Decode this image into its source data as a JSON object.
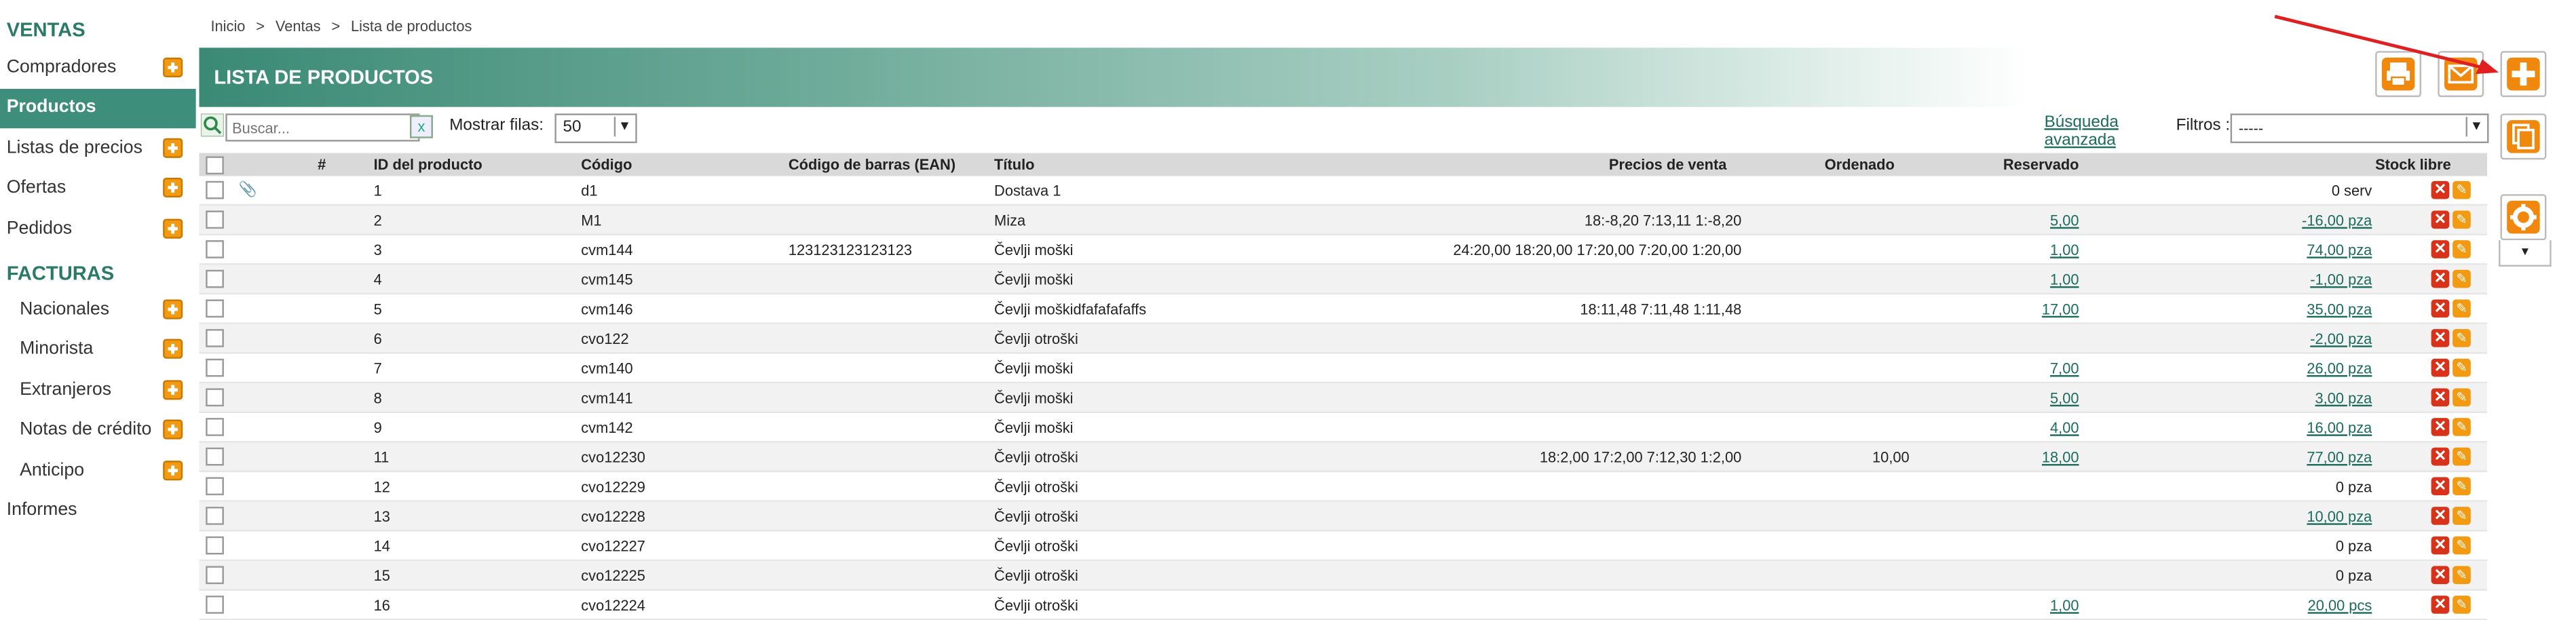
{
  "sidebar": {
    "ventas_title": "VENTAS",
    "ventas_items": [
      {
        "label": "Compradores",
        "active": false
      },
      {
        "label": "Productos",
        "active": true
      },
      {
        "label": "Listas de precios",
        "active": false
      },
      {
        "label": "Ofertas",
        "active": false
      },
      {
        "label": "Pedidos",
        "active": false
      }
    ],
    "facturas_title": "FACTURAS",
    "facturas_items": [
      {
        "label": "Nacionales"
      },
      {
        "label": "Minorista"
      },
      {
        "label": "Extranjeros"
      },
      {
        "label": "Notas de crédito"
      },
      {
        "label": "Anticipo"
      }
    ],
    "informes": "Informes"
  },
  "breadcrumb": [
    "Inicio",
    ">",
    "Ventas",
    ">",
    "Lista de productos"
  ],
  "header": {
    "title": "LISTA DE PRODUCTOS"
  },
  "toolbar": {
    "icons": [
      "print-icon",
      "mail-icon",
      "add-icon",
      "copy-icon",
      "gear-icon",
      "chevron-down-icon"
    ]
  },
  "controls": {
    "search_placeholder": "Buscar...",
    "search_clear": "x",
    "rows_label": "Mostrar filas:",
    "rows_value": "50",
    "adv_line1": "Búsqueda",
    "adv_line2": "avanzada",
    "filters_label": "Filtros :",
    "filters_value": "-----",
    "dropdown_arrow": "▼"
  },
  "table": {
    "headers": {
      "num": "#",
      "id": "ID del producto",
      "code": "Código",
      "ean": "Código de barras (EAN)",
      "title": "Título",
      "prices": "Precios de venta",
      "ordered": "Ordenado",
      "reserved": "Reservado",
      "stock": "Stock libre"
    },
    "rows": [
      {
        "id": "1",
        "code": "d1",
        "ean": "",
        "title": "Dostava 1",
        "prices": "",
        "ordered": "",
        "reserved": "",
        "stock": "0 serv",
        "stock_link": false,
        "clip": true
      },
      {
        "id": "2",
        "code": "M1",
        "ean": "",
        "title": "Miza",
        "prices": "18:-8,20 7:13,11 1:-8,20",
        "ordered": "",
        "reserved": "5,00",
        "stock": "-16,00 pza",
        "stock_link": true,
        "clip": false
      },
      {
        "id": "3",
        "code": "cvm144",
        "ean": "123123123123123",
        "title": "Čevlji moški",
        "prices": "24:20,00 18:20,00 17:20,00 7:20,00 1:20,00",
        "ordered": "",
        "reserved": "1,00",
        "stock": "74,00 pza",
        "stock_link": true,
        "clip": false
      },
      {
        "id": "4",
        "code": "cvm145",
        "ean": "",
        "title": "Čevlji moški",
        "prices": "",
        "ordered": "",
        "reserved": "1,00",
        "stock": "-1,00 pza",
        "stock_link": true,
        "clip": false
      },
      {
        "id": "5",
        "code": "cvm146",
        "ean": "",
        "title": "Čevlji moškidfafafafaffs",
        "prices": "18:11,48 7:11,48 1:11,48",
        "ordered": "",
        "reserved": "17,00",
        "stock": "35,00 pza",
        "stock_link": true,
        "clip": false
      },
      {
        "id": "6",
        "code": "cvo122",
        "ean": "",
        "title": "Čevlji otroški",
        "prices": "",
        "ordered": "",
        "reserved": "",
        "stock": "-2,00 pza",
        "stock_link": true,
        "clip": false
      },
      {
        "id": "7",
        "code": "cvm140",
        "ean": "",
        "title": "Čevlji moški",
        "prices": "",
        "ordered": "",
        "reserved": "7,00",
        "stock": "26,00 pza",
        "stock_link": true,
        "clip": false
      },
      {
        "id": "8",
        "code": "cvm141",
        "ean": "",
        "title": "Čevlji moški",
        "prices": "",
        "ordered": "",
        "reserved": "5,00",
        "stock": "3,00 pza",
        "stock_link": true,
        "clip": false
      },
      {
        "id": "9",
        "code": "cvm142",
        "ean": "",
        "title": "Čevlji moški",
        "prices": "",
        "ordered": "",
        "reserved": "4,00",
        "stock": "16,00 pza",
        "stock_link": true,
        "clip": false
      },
      {
        "id": "11",
        "code": "cvo12230",
        "ean": "",
        "title": "Čevlji otroški",
        "prices": "18:2,00 17:2,00 7:12,30 1:2,00",
        "ordered": "10,00",
        "reserved": "18,00",
        "stock": "77,00 pza",
        "stock_link": true,
        "clip": false
      },
      {
        "id": "12",
        "code": "cvo12229",
        "ean": "",
        "title": "Čevlji otroški",
        "prices": "",
        "ordered": "",
        "reserved": "",
        "stock": "0 pza",
        "stock_link": false,
        "clip": false
      },
      {
        "id": "13",
        "code": "cvo12228",
        "ean": "",
        "title": "Čevlji otroški",
        "prices": "",
        "ordered": "",
        "reserved": "",
        "stock": "10,00 pza",
        "stock_link": true,
        "clip": false
      },
      {
        "id": "14",
        "code": "cvo12227",
        "ean": "",
        "title": "Čevlji otroški",
        "prices": "",
        "ordered": "",
        "reserved": "",
        "stock": "0 pza",
        "stock_link": false,
        "clip": false
      },
      {
        "id": "15",
        "code": "cvo12225",
        "ean": "",
        "title": "Čevlji otroški",
        "prices": "",
        "ordered": "",
        "reserved": "",
        "stock": "0 pza",
        "stock_link": false,
        "clip": false
      },
      {
        "id": "16",
        "code": "cvo12224",
        "ean": "",
        "title": "Čevlji otroški",
        "prices": "",
        "ordered": "",
        "reserved": "1,00",
        "stock": "20,00 pcs",
        "stock_link": true,
        "clip": false
      }
    ]
  },
  "colors": {
    "accent": "#3d8f7b",
    "orange": "#f0880e",
    "delete": "#d8331a",
    "link": "#1b6c5c",
    "arrow": "#e02020"
  }
}
